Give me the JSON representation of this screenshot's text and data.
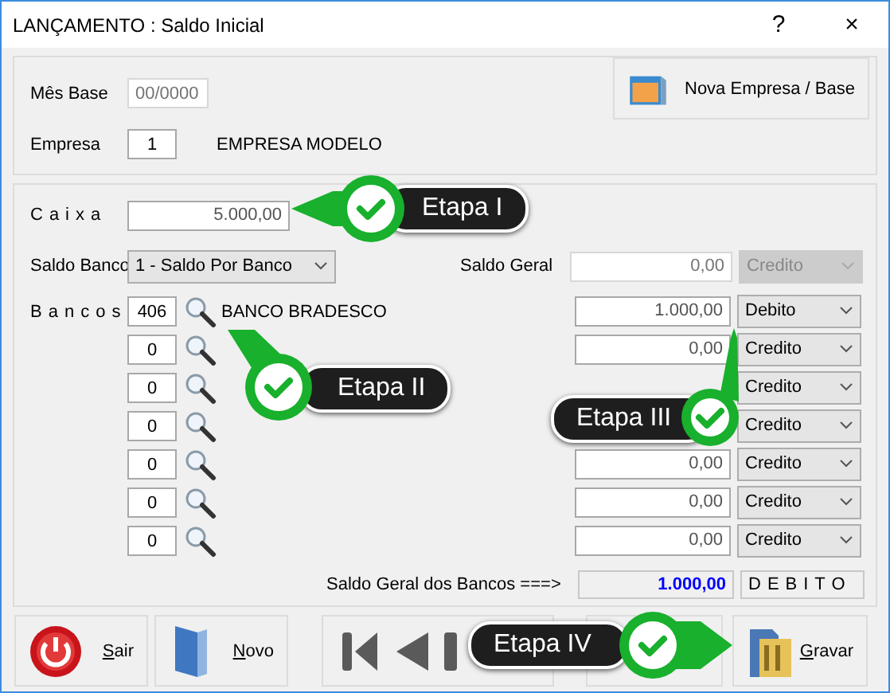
{
  "window": {
    "title": "LANÇAMENTO : Saldo Inicial",
    "help": "?",
    "close": "×"
  },
  "header": {
    "mes_base": {
      "label": "Mês Base",
      "placeholder": "00/0000"
    },
    "empresa": {
      "label": "Empresa",
      "value": "1",
      "name": "EMPRESA MODELO"
    },
    "new_button": "Nova Empresa / Base"
  },
  "caixa": {
    "label": "Caixa",
    "value": "5.000,00"
  },
  "saldo_banco": {
    "label": "Saldo Banco",
    "value": "1 - Saldo Por Banco"
  },
  "saldo_geral": {
    "label": "Saldo Geral",
    "value": "0,00",
    "type": "Credito",
    "disabled": true
  },
  "bancos": {
    "label": "Bancos",
    "rows": [
      {
        "code": "406",
        "name": "BANCO BRADESCO",
        "amount": "1.000,00",
        "type": "Debito"
      },
      {
        "code": "0",
        "amount": "0,00",
        "type": "Credito"
      },
      {
        "code": "0",
        "type": "Credito"
      },
      {
        "code": "0",
        "type": "Credito"
      },
      {
        "code": "0",
        "amount": "0,00",
        "type": "Credito"
      },
      {
        "code": "0",
        "amount": "0,00",
        "type": "Credito"
      },
      {
        "code": "0",
        "amount": "0,00",
        "type": "Credito"
      }
    ]
  },
  "total": {
    "label": "Saldo Geral dos Bancos ===>",
    "value": "1.000,00",
    "type": "DEBITO"
  },
  "buttons": [
    {
      "kind": "exit",
      "label": "Sair"
    },
    {
      "kind": "new",
      "label": "Novo"
    },
    {
      "kind": "first"
    },
    {
      "kind": "prev"
    },
    {
      "kind": "next"
    },
    {
      "kind": "save",
      "label": "Gravar"
    }
  ],
  "callouts": [
    {
      "label": "Etapa I"
    },
    {
      "label": "Etapa II"
    },
    {
      "label": "Etapa III"
    },
    {
      "label": "Etapa IV"
    }
  ]
}
